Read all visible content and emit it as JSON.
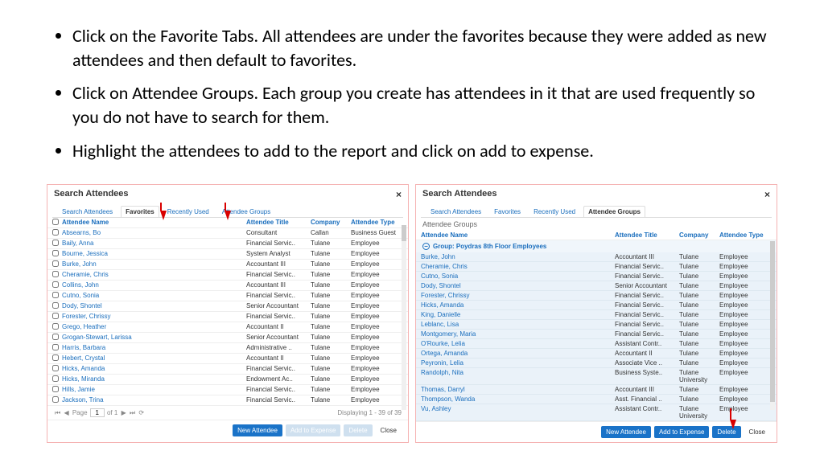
{
  "bullets": [
    "Click on the Favorite Tabs. All attendees are under the favorites because they were added as new attendees and then default to favorites.",
    "Click on Attendee Groups. Each group you create has attendees in it that are used frequently so you do not have to search for them.",
    "Highlight the attendees to add to the report and click on add to expense."
  ],
  "modalTitle": "Search Attendees",
  "tabs": [
    "Search Attendees",
    "Favorites",
    "Recently Used",
    "Attendee Groups"
  ],
  "headers": {
    "name": "Attendee Name",
    "title": "Attendee Title",
    "company": "Company",
    "type": "Attendee Type"
  },
  "left": {
    "rows": [
      {
        "name": "Absearns, Bo",
        "title": "Consultant",
        "company": "Callan",
        "type": "Business Guest"
      },
      {
        "name": "Baily, Anna",
        "title": "Financial Servic..",
        "company": "Tulane",
        "type": "Employee"
      },
      {
        "name": "Bourne, Jessica",
        "title": "System Analyst",
        "company": "Tulane",
        "type": "Employee"
      },
      {
        "name": "Burke, John",
        "title": "Accountant III",
        "company": "Tulane",
        "type": "Employee"
      },
      {
        "name": "Cheramie, Chris",
        "title": "Financial Servic..",
        "company": "Tulane",
        "type": "Employee"
      },
      {
        "name": "Collins, John",
        "title": "Accountant III",
        "company": "Tulane",
        "type": "Employee"
      },
      {
        "name": "Cutno, Sonia",
        "title": "Financial Servic..",
        "company": "Tulane",
        "type": "Employee"
      },
      {
        "name": "Dody, Shontel",
        "title": "Senior Accountant",
        "company": "Tulane",
        "type": "Employee"
      },
      {
        "name": "Forester, Chrissy",
        "title": "Financial Servic..",
        "company": "Tulane",
        "type": "Employee"
      },
      {
        "name": "Grego, Heather",
        "title": "Accountant II",
        "company": "Tulane",
        "type": "Employee"
      },
      {
        "name": "Grogan-Stewart, Larissa",
        "title": "Senior Accountant",
        "company": "Tulane",
        "type": "Employee"
      },
      {
        "name": "Harris, Barbara",
        "title": "Administrative ..",
        "company": "Tulane",
        "type": "Employee"
      },
      {
        "name": "Hebert, Crystal",
        "title": "Accountant II",
        "company": "Tulane",
        "type": "Employee"
      },
      {
        "name": "Hicks, Amanda",
        "title": "Financial Servic..",
        "company": "Tulane",
        "type": "Employee"
      },
      {
        "name": "Hicks, Miranda",
        "title": "Endowment Ac..",
        "company": "Tulane",
        "type": "Employee"
      },
      {
        "name": "Hills, Jamie",
        "title": "Financial Servic..",
        "company": "Tulane",
        "type": "Employee"
      },
      {
        "name": "Jackson, Trina",
        "title": "Financial Servic..",
        "company": "Tulane",
        "type": "Employee"
      }
    ],
    "pager": {
      "page": "1",
      "of": "of 1",
      "display": "Displaying 1 - 39 of 39",
      "pageLabel": "Page"
    },
    "buttons": {
      "new": "New Attendee",
      "add": "Add to Expense",
      "del": "Delete",
      "close": "Close"
    }
  },
  "right": {
    "subheader": "Attendee Groups",
    "group": "Group: Poydras 8th Floor Employees",
    "rows": [
      {
        "name": "Burke, John",
        "title": "Accountant III",
        "company": "Tulane",
        "type": "Employee"
      },
      {
        "name": "Cheramie, Chris",
        "title": "Financial Servic..",
        "company": "Tulane",
        "type": "Employee"
      },
      {
        "name": "Cutno, Sonia",
        "title": "Financial Servic..",
        "company": "Tulane",
        "type": "Employee"
      },
      {
        "name": "Dody, Shontel",
        "title": "Senior Accountant",
        "company": "Tulane",
        "type": "Employee"
      },
      {
        "name": "Forester, Chrissy",
        "title": "Financial Servic..",
        "company": "Tulane",
        "type": "Employee"
      },
      {
        "name": "Hicks, Amanda",
        "title": "Financial Servic..",
        "company": "Tulane",
        "type": "Employee"
      },
      {
        "name": "King, Danielle",
        "title": "Financial Servic..",
        "company": "Tulane",
        "type": "Employee"
      },
      {
        "name": "Leblanc, Lisa",
        "title": "Financial Servic..",
        "company": "Tulane",
        "type": "Employee"
      },
      {
        "name": "Montgomery, Maria",
        "title": "Financial Servic..",
        "company": "Tulane",
        "type": "Employee"
      },
      {
        "name": "O'Rourke, Lelia",
        "title": "Assistant Contr..",
        "company": "Tulane",
        "type": "Employee"
      },
      {
        "name": "Ortega, Amanda",
        "title": "Accountant II",
        "company": "Tulane",
        "type": "Employee"
      },
      {
        "name": "Peyronin, Lelia",
        "title": "Associate Vice ..",
        "company": "Tulane",
        "type": "Employee"
      },
      {
        "name": "Randolph, Nita",
        "title": "Business Syste..",
        "company": "Tulane University",
        "type": "Employee"
      },
      {
        "name": "Thomas, Darryl",
        "title": "Accountant III",
        "company": "Tulane",
        "type": "Employee"
      },
      {
        "name": "Thompson, Wanda",
        "title": "Asst. Financial ..",
        "company": "Tulane",
        "type": "Employee"
      },
      {
        "name": "Vu, Ashley",
        "title": "Assistant Contr..",
        "company": "Tulane University",
        "type": "Employee"
      }
    ],
    "buttons": {
      "new": "New Attendee",
      "add": "Add to Expense",
      "del": "Delete",
      "close": "Close"
    }
  }
}
